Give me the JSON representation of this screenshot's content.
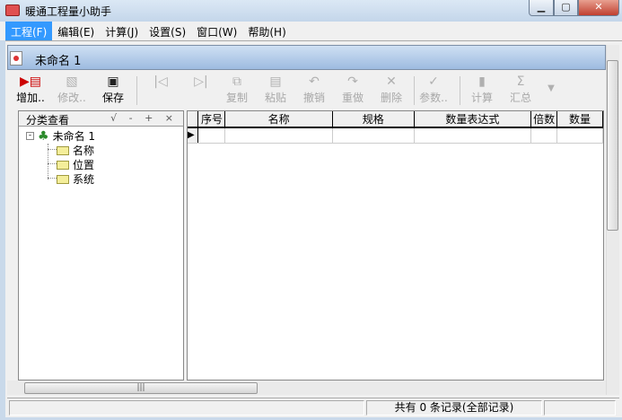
{
  "window": {
    "title": "暖通工程量小助手"
  },
  "menu": [
    "工程(F)",
    "编辑(E)",
    "计算(J)",
    "设置(S)",
    "窗口(W)",
    "帮助(H)"
  ],
  "document": {
    "title": "未命名 1"
  },
  "toolbar": [
    {
      "label": "增加..",
      "icon": "add-document-icon",
      "enabled": true
    },
    {
      "label": "修改..",
      "icon": "edit-icon",
      "enabled": false
    },
    {
      "label": "保存",
      "icon": "save-icon",
      "enabled": true
    },
    {
      "label": "",
      "icon": "move-first-icon",
      "enabled": false
    },
    {
      "label": "",
      "icon": "move-last-icon",
      "enabled": false
    },
    {
      "label": "复制",
      "icon": "copy-icon",
      "enabled": false
    },
    {
      "label": "粘贴",
      "icon": "paste-icon",
      "enabled": false
    },
    {
      "label": "撤销",
      "icon": "undo-icon",
      "enabled": false
    },
    {
      "label": "重做",
      "icon": "redo-icon",
      "enabled": false
    },
    {
      "label": "删除",
      "icon": "delete-icon",
      "enabled": false
    },
    {
      "label": "参数..",
      "icon": "spellcheck-icon",
      "enabled": false
    },
    {
      "label": "计算",
      "icon": "calculate-icon",
      "enabled": false
    },
    {
      "label": "汇总",
      "icon": "sum-icon",
      "enabled": false
    }
  ],
  "tree": {
    "header": "分类查看",
    "header_buttons": "√ - + ×",
    "root": "未命名 1",
    "children": [
      "名称",
      "位置",
      "系统"
    ]
  },
  "grid": {
    "columns": [
      "序号",
      "名称",
      "规格",
      "数量表达式",
      "倍数",
      "数量"
    ]
  },
  "status": {
    "records": "共有 0 条记录(全部记录)"
  }
}
